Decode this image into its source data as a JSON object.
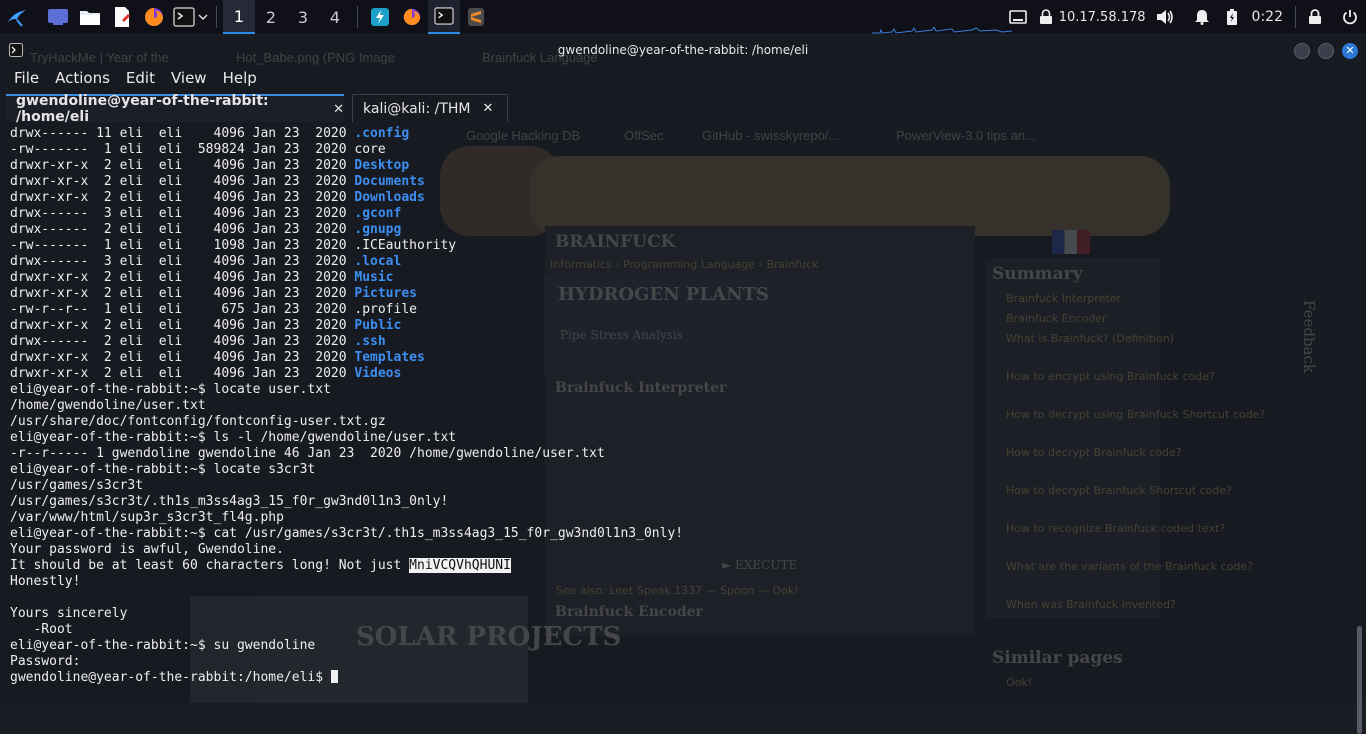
{
  "panel": {
    "workspaces": [
      "1",
      "2",
      "3",
      "4"
    ],
    "tray": {
      "ip": "10.17.58.178",
      "time": "0:22"
    }
  },
  "window": {
    "title": "gwendoline@year-of-the-rabbit: /home/eli",
    "close_glyph": "✕"
  },
  "menu": [
    "File",
    "Actions",
    "Edit",
    "View",
    "Help"
  ],
  "tabs": [
    {
      "label": "gwendoline@year-of-the-rabbit: /home/eli",
      "close": "✕"
    },
    {
      "label": "kali@kali: /THM",
      "close": "✕"
    }
  ],
  "terminal": {
    "lines": [
      {
        "pre": "drwx------ 11 eli  eli    4096 Jan 23  2020 ",
        "name": ".config",
        "dir": true
      },
      {
        "pre": "-rw-------  1 eli  eli  589824 Jan 23  2020 ",
        "name": "core",
        "dir": false
      },
      {
        "pre": "drwxr-xr-x  2 eli  eli    4096 Jan 23  2020 ",
        "name": "Desktop",
        "dir": true
      },
      {
        "pre": "drwxr-xr-x  2 eli  eli    4096 Jan 23  2020 ",
        "name": "Documents",
        "dir": true
      },
      {
        "pre": "drwxr-xr-x  2 eli  eli    4096 Jan 23  2020 ",
        "name": "Downloads",
        "dir": true
      },
      {
        "pre": "drwx------  3 eli  eli    4096 Jan 23  2020 ",
        "name": ".gconf",
        "dir": true
      },
      {
        "pre": "drwx------  2 eli  eli    4096 Jan 23  2020 ",
        "name": ".gnupg",
        "dir": true
      },
      {
        "pre": "-rw-------  1 eli  eli    1098 Jan 23  2020 ",
        "name": ".ICEauthority",
        "dir": false
      },
      {
        "pre": "drwx------  3 eli  eli    4096 Jan 23  2020 ",
        "name": ".local",
        "dir": true
      },
      {
        "pre": "drwxr-xr-x  2 eli  eli    4096 Jan 23  2020 ",
        "name": "Music",
        "dir": true
      },
      {
        "pre": "drwxr-xr-x  2 eli  eli    4096 Jan 23  2020 ",
        "name": "Pictures",
        "dir": true
      },
      {
        "pre": "-rw-r--r--  1 eli  eli     675 Jan 23  2020 ",
        "name": ".profile",
        "dir": false
      },
      {
        "pre": "drwxr-xr-x  2 eli  eli    4096 Jan 23  2020 ",
        "name": "Public",
        "dir": true
      },
      {
        "pre": "drwx------  2 eli  eli    4096 Jan 23  2020 ",
        "name": ".ssh",
        "dir": true
      },
      {
        "pre": "drwxr-xr-x  2 eli  eli    4096 Jan 23  2020 ",
        "name": "Templates",
        "dir": true
      },
      {
        "pre": "drwxr-xr-x  2 eli  eli    4096 Jan 23  2020 ",
        "name": "Videos",
        "dir": true
      },
      {
        "pre": "eli@year-of-the-rabbit:~$ locate user.txt"
      },
      {
        "pre": "/home/gwendoline/user.txt"
      },
      {
        "pre": "/usr/share/doc/fontconfig/fontconfig-user.txt.gz"
      },
      {
        "pre": "eli@year-of-the-rabbit:~$ ls -l /home/gwendoline/user.txt"
      },
      {
        "pre": "-r--r----- 1 gwendoline gwendoline 46 Jan 23  2020 /home/gwendoline/user.txt"
      },
      {
        "pre": "eli@year-of-the-rabbit:~$ locate s3cr3t"
      },
      {
        "pre": "/usr/games/s3cr3t"
      },
      {
        "pre": "/usr/games/s3cr3t/.th1s_m3ss4ag3_15_f0r_gw3nd0l1n3_0nly!"
      },
      {
        "pre": "/var/www/html/sup3r_s3cr3t_fl4g.php"
      },
      {
        "pre": "eli@year-of-the-rabbit:~$ cat /usr/games/s3cr3t/.th1s_m3ss4ag3_15_f0r_gw3nd0l1n3_0nly!"
      },
      {
        "pre": "Your password is awful, Gwendoline."
      },
      {
        "pre": "It should be at least 60 characters long! Not just ",
        "highlight": "MniVCQVhQHUNI"
      },
      {
        "pre": "Honestly!"
      },
      {
        "pre": ""
      },
      {
        "pre": "Yours sincerely"
      },
      {
        "pre": "   -Root"
      },
      {
        "pre": "eli@year-of-the-rabbit:~$ su gwendoline"
      },
      {
        "pre": "Password:"
      },
      {
        "pre": "gwendoline@year-of-the-rabbit:/home/eli$ ",
        "cursor": true
      }
    ]
  },
  "background_page": {
    "tabs": [
      "TryHackMe | Year of the",
      "Hot_Babe.png (PNG Image",
      "Brainfuck Language"
    ],
    "bookmarks": [
      "Google Hacking DB",
      "OffSec",
      "GitHub - swisskyrepo/...",
      "PowerView-3.0 tips an..."
    ],
    "brand": "BRAINFUCK",
    "breadcrumb": "Informatics › Programming Language › Brainfuck",
    "ad_1": "HYDROGEN PLANTS",
    "ad_1_sub": "Pipe Stress Analysis",
    "section_1": "Brainfuck Interpreter",
    "section_2": "Brainfuck Encoder",
    "execute": "► EXECUTE",
    "see_also": "See also: Leet Speak 1337 — Spoon — Ook!",
    "summary_title": "Summary",
    "summary_items": [
      "Brainfuck Interpreter",
      "Brainfuck Encoder",
      "What is Brainfuck? (Definition)",
      "How to encrypt using Brainfuck code?",
      "How to decrypt using Brainfuck Shortcut code?",
      "How to decrypt Brainfuck code?",
      "How to decrypt Brainfuck Shortcut code?",
      "How to recognize Brainfuck coded text?",
      "What are the variants of the Brainfuck code?",
      "When was Brainfuck invented?"
    ],
    "similar": "Similar pages",
    "similar_items": [
      "Ook!"
    ],
    "feedback": "Feedback",
    "ad_2": "SOLAR PROJECTS"
  }
}
